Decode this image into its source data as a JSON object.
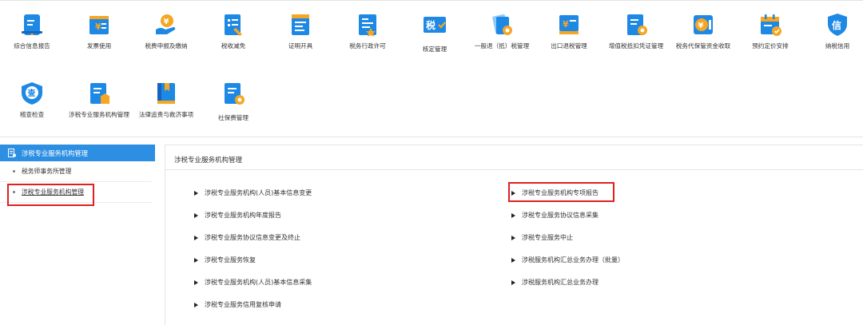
{
  "top_menu": {
    "row1": [
      {
        "label": "综合信息报告",
        "icon": "computer-report-icon"
      },
      {
        "label": "发票使用",
        "icon": "invoice-icon"
      },
      {
        "label": "税费申报及缴纳",
        "icon": "tax-payment-icon"
      },
      {
        "label": "税收减免",
        "icon": "tax-reduction-icon"
      },
      {
        "label": "证明开具",
        "icon": "certificate-icon"
      },
      {
        "label": "税务行政许可",
        "icon": "permit-icon"
      },
      {
        "label": "核定管理",
        "icon": "tax-assessment-icon",
        "glyph": "税"
      },
      {
        "label": "一般退（抵）税管理",
        "icon": "tax-refund-icon"
      },
      {
        "label": "出口退税管理",
        "icon": "export-refund-icon"
      },
      {
        "label": "增值税抵扣凭证管理",
        "icon": "vat-voucher-icon"
      },
      {
        "label": "税务代保管资金收取",
        "icon": "custody-fund-icon"
      },
      {
        "label": "预约定价安排",
        "icon": "calendar-icon"
      },
      {
        "label": "纳税信用",
        "icon": "credit-icon",
        "glyph": "信"
      }
    ],
    "row2": [
      {
        "label": "稽查检查",
        "icon": "inspection-shield-icon",
        "glyph": "查"
      },
      {
        "label": "涉税专业服务机构管理",
        "icon": "agency-management-icon"
      },
      {
        "label": "法律追责与救济事项",
        "icon": "legal-book-icon"
      },
      {
        "label": "社保费管理",
        "icon": "social-insurance-icon"
      }
    ]
  },
  "sidebar": {
    "title": "涉税专业服务机构管理",
    "items": [
      {
        "label": "税务师事务所管理"
      },
      {
        "label": "涉税专业服务机构管理"
      }
    ]
  },
  "content": {
    "title": "涉税专业服务机构管理",
    "links_left": [
      "涉税专业服务机构(人员)基本信息变更",
      "涉税专业服务机构年度报告",
      "涉税专业服务协议信息变更及终止",
      "涉税专业服务恢复",
      "涉税专业服务机构(人员)基本信息采集",
      "涉税专业服务信用复核申请"
    ],
    "links_right": [
      "涉税专业服务机构专项报告",
      "涉税专业服务协议信息采集",
      "涉税专业服务中止",
      "涉税服务机构汇总业务办理（批量）",
      "涉税服务机构汇总业务办理"
    ]
  },
  "colors": {
    "accent": "#2d8fe2",
    "icon_blue": "#1e88e5",
    "icon_orange": "#f5a623",
    "highlight": "#e02020"
  }
}
